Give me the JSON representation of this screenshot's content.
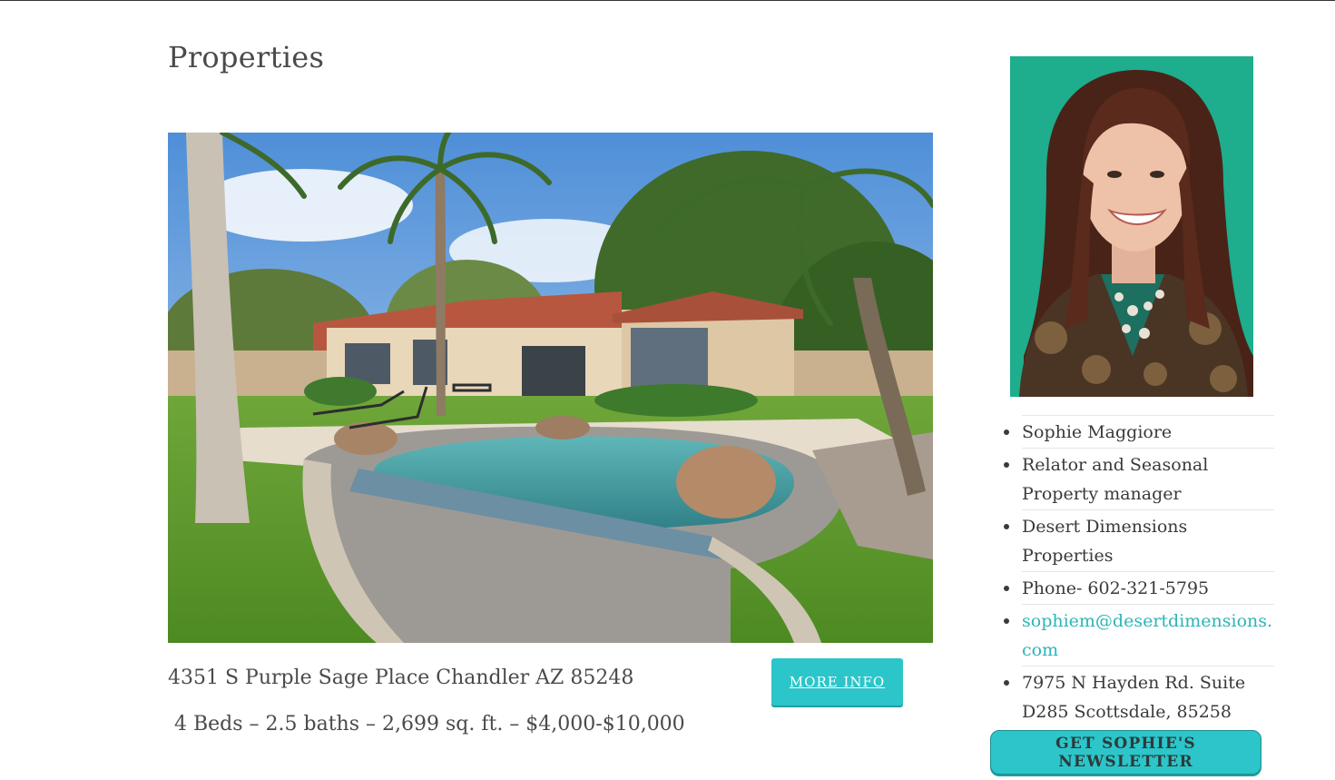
{
  "page": {
    "title": "Properties"
  },
  "listing": {
    "address": "4351 S Purple Sage Place Chandler AZ 85248",
    "details": " 4 Beds – 2.5 baths – 2,699 sq. ft. – $4,000-$10,000",
    "more_info_label": "MORE INFO",
    "image_icon": "house-with-pool-photo"
  },
  "sidebar": {
    "photo_icon": "agent-portrait-photo",
    "contact": {
      "name": "Sophie Maggiore",
      "role": "Relator and Seasonal Property manager",
      "company": "Desert Dimensions Properties",
      "phone": "Phone- 602-321-5795",
      "email": "sophiem@desertdimensions.com",
      "address": "7975 N Hayden Rd. Suite D285 Scottsdale, 85258"
    },
    "newsletter_label": "GET SOPHIE'S NEWSLETTER"
  },
  "colors": {
    "accent": "#2cc5c9",
    "link": "#2cb5b8",
    "text": "#4a4a4a"
  }
}
